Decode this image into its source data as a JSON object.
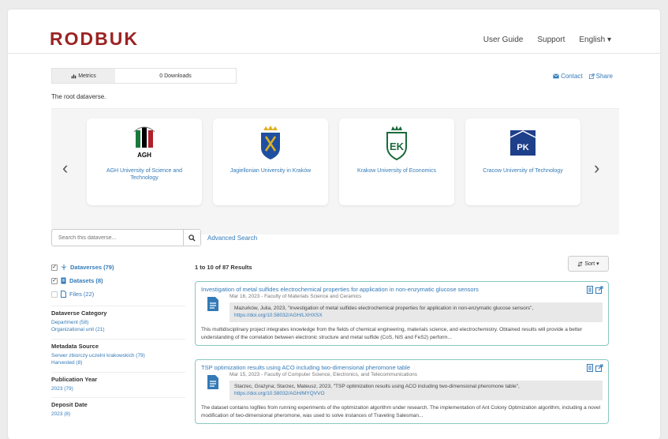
{
  "header": {
    "logo": "RODBUK",
    "nav": [
      "User Guide",
      "Support",
      "English ▾"
    ]
  },
  "metrics": {
    "tab_label": "Metrics",
    "downloads": "0 Downloads"
  },
  "actions": {
    "contact": "Contact",
    "share": "Share"
  },
  "root_description": "The root dataverse.",
  "carousel": {
    "cards": [
      {
        "name": "AGH University of Science and Technology",
        "icon": "agh-logo"
      },
      {
        "name": "Jagiellonian University in Kraków",
        "icon": "jagiellonian-logo"
      },
      {
        "name": "Krakow University of Economics",
        "icon": "uek-logo"
      },
      {
        "name": "Cracow University of Technology",
        "icon": "pk-logo"
      }
    ]
  },
  "search": {
    "placeholder": "Search this dataverse...",
    "advanced": "Advanced Search"
  },
  "facets": {
    "types": [
      {
        "label": "Dataverses (79)",
        "checked": true
      },
      {
        "label": "Datasets (8)",
        "checked": true
      },
      {
        "label": "Files (22)",
        "checked": false
      }
    ],
    "groups": [
      {
        "title": "Dataverse Category",
        "items": [
          "Department (58)",
          "Organizational unit (21)"
        ]
      },
      {
        "title": "Metadata Source",
        "items": [
          "Serwer zbiorczy uczelni krakowskich (79)",
          "Harvested (8)"
        ]
      },
      {
        "title": "Publication Year",
        "items": [
          "2023 (79)"
        ]
      },
      {
        "title": "Deposit Date",
        "items": [
          "2023 (8)"
        ]
      }
    ]
  },
  "results": {
    "count": "1 to 10 of 87 Results",
    "sort_label": "Sort",
    "items": [
      {
        "title": "Investigation of metal sulfides electrochemical properties for application in non-enzymatic glucose sensors",
        "meta": "Mar 16, 2023 - Faculty of Materials Science and Ceramics",
        "citation": "Mazurków, Julia, 2023, \"Investigation of metal sulfides electrochemical properties for application in non-enzymatic glucose sensors\",",
        "doi": "https://doi.org/10.58032/AGH/LXHXSX",
        "description": "This multidisciplinary project integrates knowledge from the fields of chemical engineering, materials science, and electrochemistry. Obtained results will provide a better understanding of the correlation between electronic structure and metal sulfide (CoS, NiS and FeS2) perform..."
      },
      {
        "title": "TSP optimization results using ACO including two-dimensional pheromone table",
        "meta": "Mar 15, 2023 - Faculty of Computer Science, Electronics, and Telecommunications",
        "citation": "Starzec, Grażyna; Starzec, Mateusz, 2023, \"TSP optimization results using ACO including two-dimensional pheromone table\",",
        "doi": "https://doi.org/10.58032/AGH/MYQVVO",
        "description": "The dataset contains logfiles from running experiments of the optimization algorithm under research. The implementation of Ant Colony Optimization algorithm, including a novel modification of two-dimensional pheromone, was used to solve instances of Traveling Salesman..."
      }
    ]
  },
  "colors": {
    "brand": "#9b2323",
    "link": "#337ab7",
    "result_border": "#88c8c2"
  }
}
